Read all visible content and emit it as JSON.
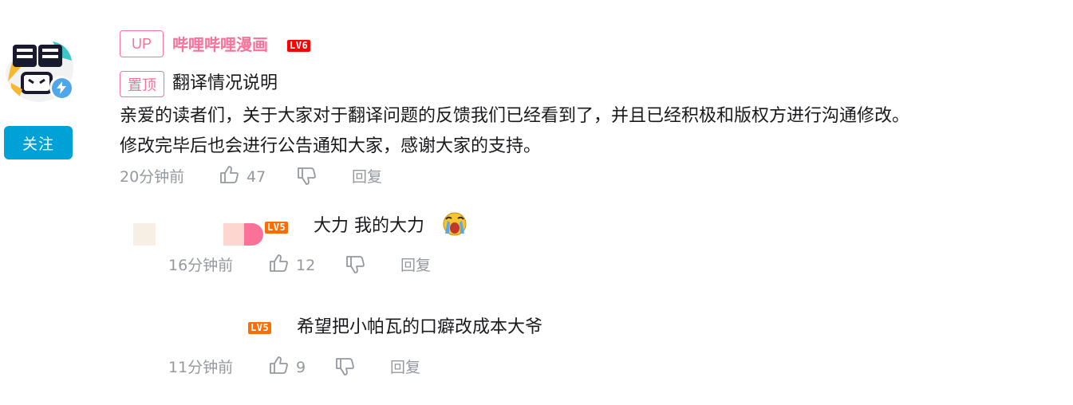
{
  "comment": {
    "up_tag": "UP",
    "username": "哔哩哔哩漫画",
    "level_badge": "LV6",
    "follow_label": "关注",
    "pin_tag": "置顶",
    "pin_title": "翻译情况说明",
    "body_lines": [
      "亲爱的读者们，关于大家对于翻译问题的反馈我们已经看到了，并且已经积极和版权方进行沟通修改。",
      "修改完毕后也会进行公告通知大家，感谢大家的支持。"
    ],
    "time": "20分钟前",
    "likes": "47",
    "reply_label": "回复",
    "colors": {
      "accent_pink": "#fb7299",
      "follow_blue": "#00a1d6",
      "meta_gray": "#9499a0",
      "lv6_red": "#ff0000",
      "lv5_orange": "#ff6c00"
    }
  },
  "replies": [
    {
      "level_badge": "LV5",
      "text": "大力 我的大力",
      "emoji": "crying-face-emoji",
      "time": "16分钟前",
      "likes": "12",
      "reply_label": "回复"
    },
    {
      "level_badge": "LV5",
      "text": "希望把小帕瓦的口癖改成本大爷",
      "time": "11分钟前",
      "likes": "9",
      "reply_label": "回复"
    }
  ]
}
